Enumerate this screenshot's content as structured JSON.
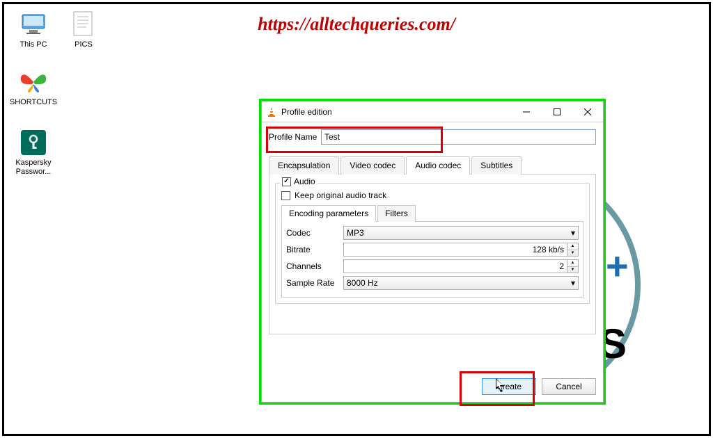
{
  "watermark_url": "https://alltechqueries.com/",
  "desktop_icons": {
    "this_pc": "This PC",
    "pics": "PICS",
    "shortcuts": "SHORTCUTS",
    "kaspersky": "Kaspersky Passwor..."
  },
  "dialog": {
    "title": "Profile edition",
    "profile_name_label": "Profile Name",
    "profile_name_value": "Test",
    "tabs": {
      "encapsulation": "Encapsulation",
      "video_codec": "Video codec",
      "audio_codec": "Audio codec",
      "subtitles": "Subtitles"
    },
    "audio_group": {
      "audio_checkbox_label": "Audio",
      "keep_original_label": "Keep original audio track"
    },
    "subtabs": {
      "encoding": "Encoding parameters",
      "filters": "Filters"
    },
    "params": {
      "codec_label": "Codec",
      "codec_value": "MP3",
      "bitrate_label": "Bitrate",
      "bitrate_value": "128 kb/s",
      "channels_label": "Channels",
      "channels_value": "2",
      "samplerate_label": "Sample Rate",
      "samplerate_value": "8000 Hz"
    },
    "buttons": {
      "create": "Create",
      "cancel": "Cancel"
    }
  }
}
